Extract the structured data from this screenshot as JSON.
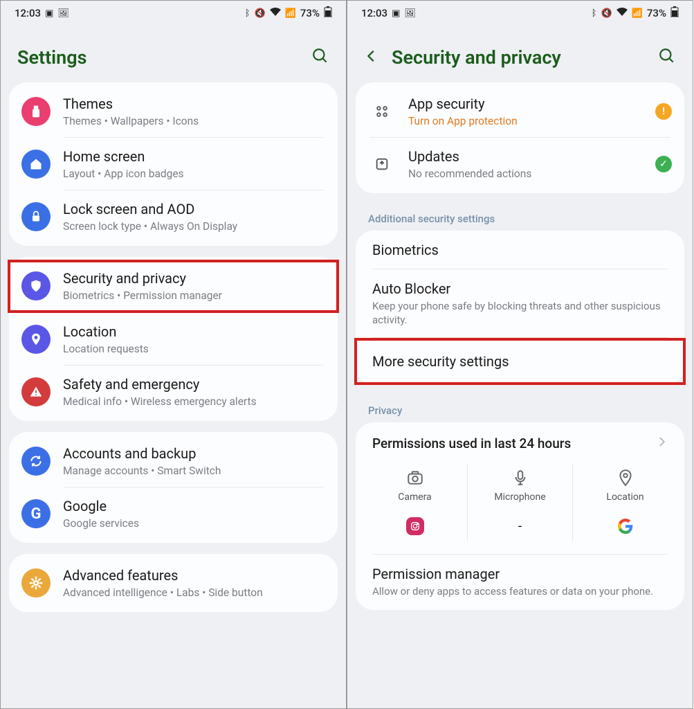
{
  "status": {
    "time": "12:03",
    "battery": "73%"
  },
  "left": {
    "title": "Settings",
    "items": [
      {
        "title": "Themes",
        "sub": "Themes  •  Wallpapers  •  Icons",
        "iconColor": "#e93e6f",
        "icon": "themes"
      },
      {
        "title": "Home screen",
        "sub": "Layout  •  App icon badges",
        "iconColor": "#3b6fe5",
        "icon": "home"
      },
      {
        "title": "Lock screen and AOD",
        "sub": "Screen lock type  •  Always On Display",
        "iconColor": "#3b6fe5",
        "icon": "lock"
      },
      {
        "title": "Security and privacy",
        "sub": "Biometrics  •  Permission manager",
        "iconColor": "#5a56e6",
        "icon": "shield",
        "highlight": true
      },
      {
        "title": "Location",
        "sub": "Location requests",
        "iconColor": "#5a56e6",
        "icon": "pin"
      },
      {
        "title": "Safety and emergency",
        "sub": "Medical info  •  Wireless emergency alerts",
        "iconColor": "#d23c3c",
        "icon": "alert"
      },
      {
        "title": "Accounts and backup",
        "sub": "Manage accounts  •  Smart Switch",
        "iconColor": "#3b6fe5",
        "icon": "sync"
      },
      {
        "title": "Google",
        "sub": "Google services",
        "iconColor": "#3b6fe5",
        "icon": "google"
      },
      {
        "title": "Advanced features",
        "sub": "Advanced intelligence  •  Labs  •  Side button",
        "iconColor": "#eaa83a",
        "icon": "gear"
      }
    ]
  },
  "right": {
    "title": "Security and privacy",
    "top": [
      {
        "title": "App security",
        "sub": "Turn on App protection",
        "warn": true,
        "badge": "warn",
        "icon": "apps"
      },
      {
        "title": "Updates",
        "sub": "No recommended actions",
        "badge": "ok",
        "icon": "update"
      }
    ],
    "sectionA": "Additional security settings",
    "sec_items": [
      {
        "title": "Biometrics"
      },
      {
        "title": "Auto Blocker",
        "sub": "Keep your phone safe by blocking threats and other suspicious activity."
      },
      {
        "title": "More security settings",
        "highlight": true
      }
    ],
    "sectionB": "Privacy",
    "perm_head": "Permissions used in last 24 hours",
    "perm_cols": [
      {
        "label": "Camera",
        "icon": "camera",
        "app": "instagram"
      },
      {
        "label": "Microphone",
        "icon": "mic",
        "app": "-"
      },
      {
        "label": "Location",
        "icon": "loc",
        "app": "google"
      }
    ],
    "perm_manager": {
      "title": "Permission manager",
      "sub": "Allow or deny apps to access features or data on your phone."
    }
  }
}
